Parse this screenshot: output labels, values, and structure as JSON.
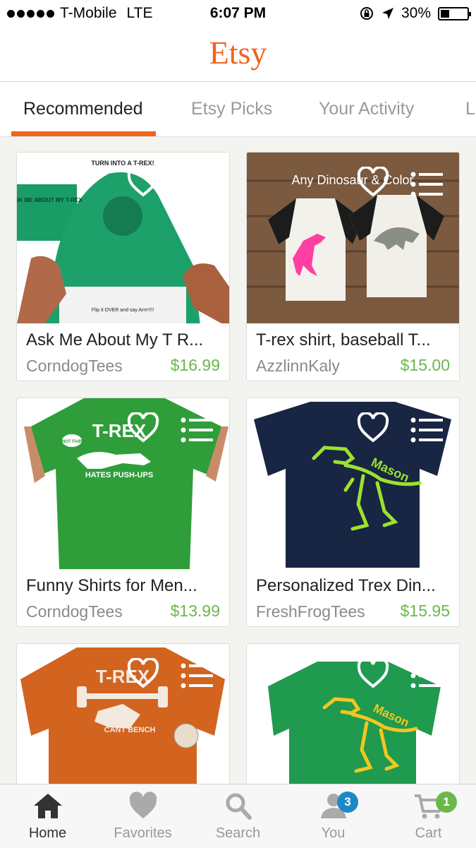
{
  "status_bar": {
    "carrier": "T-Mobile",
    "network": "LTE",
    "time": "6:07 PM",
    "battery": "30%",
    "battery_level": 0.3,
    "icons": [
      "signal-dots-icon",
      "rotation-lock-icon",
      "location-arrow-icon",
      "battery-icon"
    ]
  },
  "header": {
    "logo": "Etsy",
    "brand_color": "#f1641e"
  },
  "tabs": [
    {
      "label": "Recommended",
      "active": true
    },
    {
      "label": "Etsy Picks",
      "active": false
    },
    {
      "label": "Your Activity",
      "active": false
    },
    {
      "label": "L",
      "active": false
    }
  ],
  "listings": [
    {
      "title": "Ask Me About My T R...",
      "shop": "CorndogTees",
      "price": "$16.99",
      "image_text_top": "TURN INTO A T-REX!",
      "image_text_shirt": "ASK ME ABOUT MY T-REX",
      "image_text_bottom": "Flip it OVER and say Arrrr!!!!"
    },
    {
      "title": "T-rex shirt, baseball T...",
      "shop": "AzzlinnKaly",
      "price": "$15.00",
      "image_text_top": "Any Dinosaur & Color"
    },
    {
      "title": "Funny Shirts for Men...",
      "shop": "CorndogTees",
      "price": "$13.99",
      "image_text_top": "T-REX",
      "image_text_bottom": "HATES PUSH-UPS",
      "image_text_bubble": "NOT FAIR"
    },
    {
      "title": "Personalized Trex Din...",
      "shop": "FreshFrogTees",
      "price": "$15.95",
      "image_text_top": "Mason"
    },
    {
      "title": "",
      "shop": "",
      "price": "",
      "image_text_top": "T-REX",
      "image_text_bottom": "CANT BENCH"
    },
    {
      "title": "",
      "shop": "",
      "price": "",
      "image_text_top": "Mason"
    }
  ],
  "bottom_nav": [
    {
      "label": "Home",
      "icon": "home-icon",
      "active": true
    },
    {
      "label": "Favorites",
      "icon": "heart-icon",
      "active": false
    },
    {
      "label": "Search",
      "icon": "search-icon",
      "active": false
    },
    {
      "label": "You",
      "icon": "user-icon",
      "active": false,
      "badge": "3",
      "badge_color": "#1e88c7"
    },
    {
      "label": "Cart",
      "icon": "cart-icon",
      "active": false,
      "badge": "1",
      "badge_color": "#6bb84a"
    }
  ],
  "colors": {
    "accent": "#f1641e",
    "price": "#6bb84a"
  }
}
